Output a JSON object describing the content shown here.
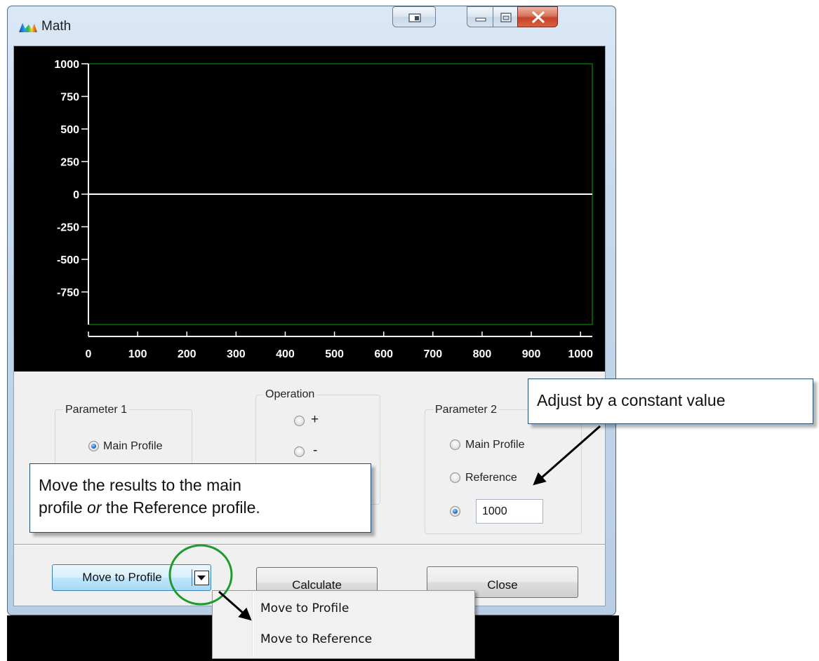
{
  "window": {
    "title": "Math",
    "app_icon": "spectrum-app-icon",
    "controls": [
      "snap-icon",
      "minimize-icon",
      "maximize-icon",
      "close-icon"
    ]
  },
  "chart_data": {
    "type": "line",
    "title": "",
    "xlabel": "",
    "ylabel": "",
    "xlim": [
      0,
      1024
    ],
    "ylim": [
      -1000,
      1000
    ],
    "x_ticks": [
      "0",
      "100",
      "200",
      "300",
      "400",
      "500",
      "600",
      "700",
      "800",
      "900",
      "1000"
    ],
    "y_ticks": [
      "1000",
      "750",
      "500",
      "250",
      "0",
      "-250",
      "-500",
      "-750"
    ],
    "series": [
      {
        "x": [
          0,
          1024
        ],
        "y": [
          0,
          0
        ],
        "color": "#ffffff"
      }
    ],
    "background": "#000000",
    "frame_color": "#00aa00",
    "grid": false
  },
  "parameter1": {
    "title": "Parameter 1",
    "options": [
      {
        "label": "Main Profile",
        "checked": true
      }
    ]
  },
  "operation": {
    "title": "Operation",
    "options": [
      {
        "label": "+",
        "checked": false
      },
      {
        "label": "-",
        "checked": false
      }
    ]
  },
  "parameter2": {
    "title": "Parameter 2",
    "options": [
      {
        "label": "Main Profile",
        "checked": false
      },
      {
        "label": "Reference",
        "checked": false
      },
      {
        "label": "",
        "checked": true
      }
    ],
    "constant_value": "1000"
  },
  "buttons": {
    "move_label": "Move to Profile",
    "calculate_label": "Calculate",
    "close_label": "Close"
  },
  "dropdown": {
    "items": [
      "Move to Profile",
      "Move to Reference"
    ]
  },
  "callouts": {
    "move_results_line1": "Move the results to the main",
    "move_results_line2_pre": "profile ",
    "move_results_line2_em": "or",
    "move_results_line2_post": " the Reference profile.",
    "adjust": "Adjust by a constant value"
  },
  "colors": {
    "plot_background": "#000000",
    "frame": "#00aa00",
    "axis": "#ffffff",
    "callout_border": "#1f4e79",
    "highlight_circle": "#1f9a2e",
    "accent": "#2a73c4"
  }
}
